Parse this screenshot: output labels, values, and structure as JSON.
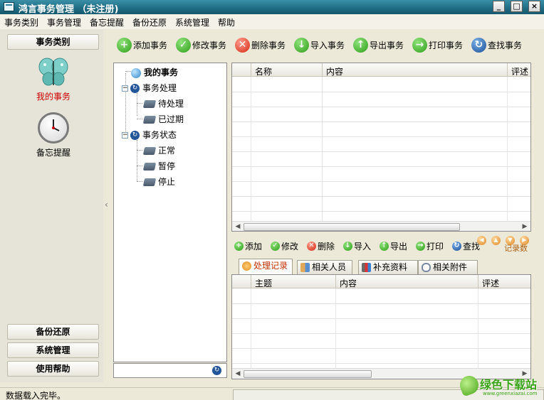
{
  "window": {
    "title": "鸿言事务管理 （未注册)"
  },
  "menu": [
    "事务类别",
    "事务管理",
    "备忘提醒",
    "备份还原",
    "系统管理",
    "帮助"
  ],
  "left_panel": {
    "header": "事务类别",
    "nav": [
      {
        "label": "我的事务",
        "icon": "butterfly-icon",
        "active": true
      },
      {
        "label": "备忘提醒",
        "icon": "clock-icon",
        "active": false
      }
    ],
    "bottom_buttons": [
      "备份还原",
      "系统管理",
      "使用帮助"
    ]
  },
  "toolbar": [
    {
      "label": "添加事务",
      "icon": "add-icon"
    },
    {
      "label": "修改事务",
      "icon": "check-icon"
    },
    {
      "label": "删除事务",
      "icon": "delete-icon"
    },
    {
      "label": "导入事务",
      "icon": "import-icon"
    },
    {
      "label": "导出事务",
      "icon": "export-icon"
    },
    {
      "label": "打印事务",
      "icon": "print-icon"
    },
    {
      "label": "查找事务",
      "icon": "search-icon"
    }
  ],
  "tree": {
    "root": "我的事务",
    "groups": [
      {
        "label": "事务处理",
        "children": [
          "待处理",
          "已过期"
        ]
      },
      {
        "label": "事务状态",
        "children": [
          "正常",
          "暂停",
          "停止"
        ]
      }
    ]
  },
  "grid_top": {
    "columns": [
      "名称",
      "内容",
      "评述"
    ],
    "rows": []
  },
  "sub_toolbar": [
    {
      "label": "添加",
      "icon": "add-icon"
    },
    {
      "label": "修改",
      "icon": "check-icon"
    },
    {
      "label": "删除",
      "icon": "delete-icon"
    },
    {
      "label": "导入",
      "icon": "import-icon"
    },
    {
      "label": "导出",
      "icon": "export-icon"
    },
    {
      "label": "打印",
      "icon": "print-icon"
    },
    {
      "label": "查找",
      "icon": "search-icon"
    }
  ],
  "record_label": "记录数",
  "tabs": [
    {
      "label": "处理记录",
      "active": true
    },
    {
      "label": "相关人员",
      "active": false
    },
    {
      "label": "补充资料",
      "active": false
    },
    {
      "label": "相关附件",
      "active": false
    }
  ],
  "grid_bottom": {
    "columns": [
      "主题",
      "内容",
      "评述"
    ],
    "rows": []
  },
  "status": {
    "text": "数据载入完毕。"
  },
  "watermark": {
    "text": "绿色下载站",
    "url": "www.greenxiazai.com"
  },
  "colors": {
    "title_bar": "#1f6b82",
    "active_nav": "#cc0000",
    "active_tab": "#c03000"
  }
}
